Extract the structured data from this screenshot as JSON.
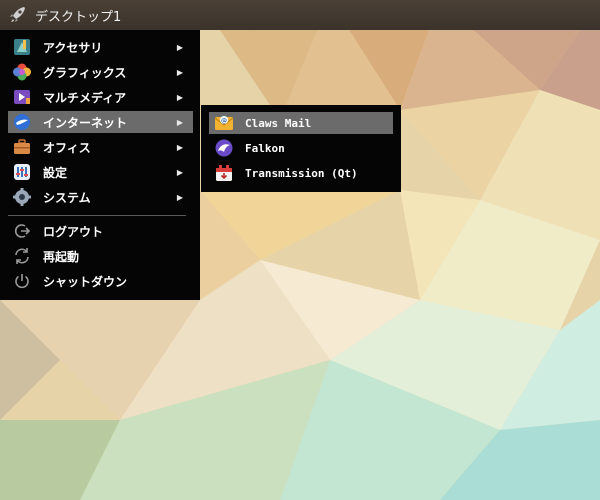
{
  "panel": {
    "title": "デスクトップ1",
    "menu_icon": "rocket-icon"
  },
  "main_menu": {
    "items": [
      {
        "label": "アクセサリ",
        "icon": "accessories-icon",
        "has_submenu": true
      },
      {
        "label": "グラフィックス",
        "icon": "graphics-icon",
        "has_submenu": true
      },
      {
        "label": "マルチメディア",
        "icon": "multimedia-icon",
        "has_submenu": true
      },
      {
        "label": "インターネット",
        "icon": "internet-icon",
        "has_submenu": true,
        "selected": true
      },
      {
        "label": "オフィス",
        "icon": "office-icon",
        "has_submenu": true
      },
      {
        "label": "設定",
        "icon": "settings-icon",
        "has_submenu": true
      },
      {
        "label": "システム",
        "icon": "system-icon",
        "has_submenu": true
      }
    ],
    "session": [
      {
        "label": "ログアウト",
        "icon": "logout-icon"
      },
      {
        "label": "再起動",
        "icon": "reboot-icon"
      },
      {
        "label": "シャットダウン",
        "icon": "power-icon"
      }
    ],
    "arrow": "▶"
  },
  "sub_menu": {
    "items": [
      {
        "label": "Claws Mail",
        "icon": "claws-mail-icon",
        "selected": true
      },
      {
        "label": "Falkon",
        "icon": "falkon-icon"
      },
      {
        "label": "Transmission (Qt)",
        "icon": "transmission-icon"
      }
    ]
  },
  "colors": {
    "menu_bg": "#050505",
    "selection": "#6b6b6b",
    "panel_bg": "#403830"
  }
}
